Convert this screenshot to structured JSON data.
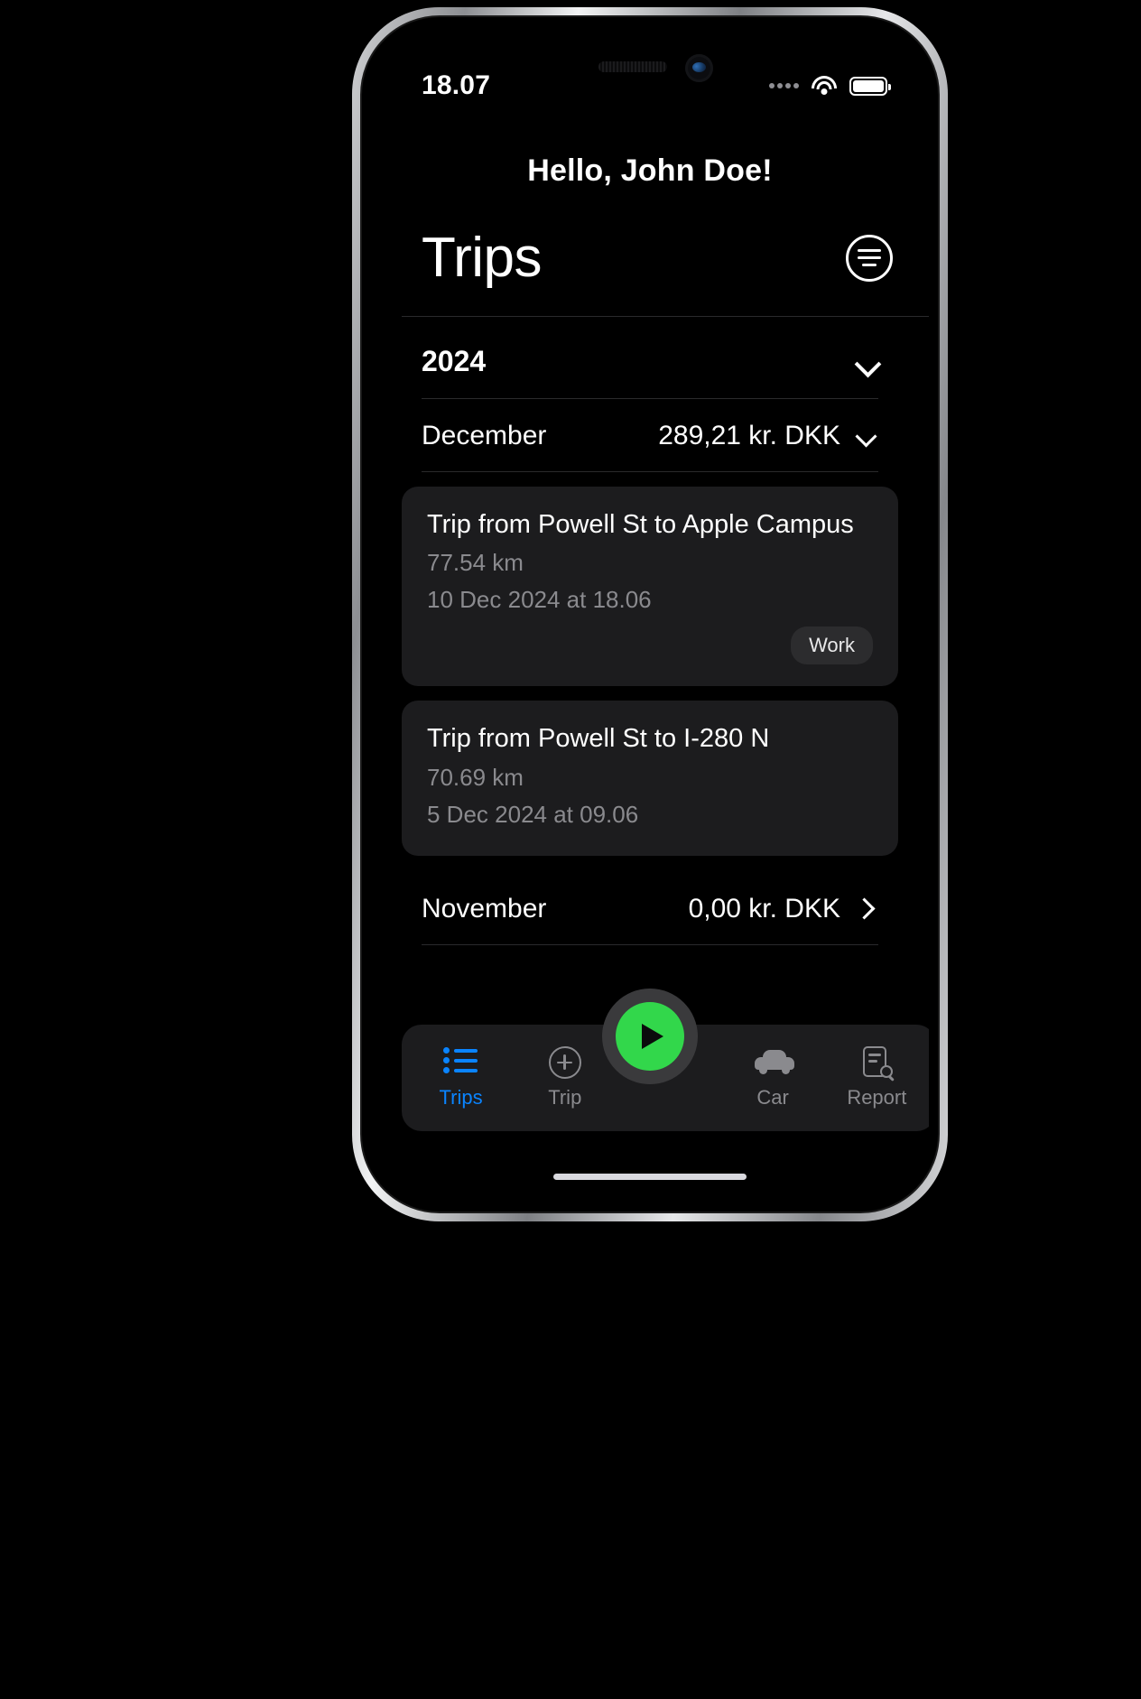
{
  "status_bar": {
    "time": "18.07",
    "cellular_icon": "signal-dots-icon",
    "wifi_icon": "wifi-icon",
    "battery_icon": "battery-icon"
  },
  "header": {
    "greeting": "Hello, John Doe!",
    "title": "Trips",
    "filter_icon": "filter-lines-icon"
  },
  "colors": {
    "accent_blue": "#0A84FF",
    "record_green": "#32D74B",
    "card_bg": "#1C1C1E",
    "tag_bg": "#2C2C2E",
    "secondary_text": "#8A8A8E",
    "screen_bg": "#000000"
  },
  "list": {
    "year": {
      "label": "2024",
      "chevron_icon": "chevron-down-icon"
    },
    "months": [
      {
        "label": "December",
        "amount": "289,21 kr. DKK",
        "chevron_icon": "chevron-down-icon",
        "expanded": true
      },
      {
        "label": "November",
        "amount": "0,00 kr. DKK",
        "chevron_icon": "chevron-right-icon",
        "expanded": false
      }
    ],
    "trips": [
      {
        "title": "Trip from Powell St to Apple Campus",
        "distance": "77.54 km",
        "datetime": "10 Dec 2024 at 18.06",
        "tag": "Work"
      },
      {
        "title": "Trip from Powell St to I-280 N",
        "distance": "70.69 km",
        "datetime": "5 Dec 2024 at 09.06",
        "tag": ""
      }
    ]
  },
  "tabbar": {
    "items": [
      {
        "label": "Trips",
        "icon": "list-icon",
        "active": true
      },
      {
        "label": "Trip",
        "icon": "plus-circle-icon",
        "active": false
      },
      {
        "label": "Car",
        "icon": "car-icon",
        "active": false
      },
      {
        "label": "Report",
        "icon": "document-search-icon",
        "active": false
      }
    ],
    "record_button": {
      "icon": "play-icon",
      "label": ""
    }
  }
}
